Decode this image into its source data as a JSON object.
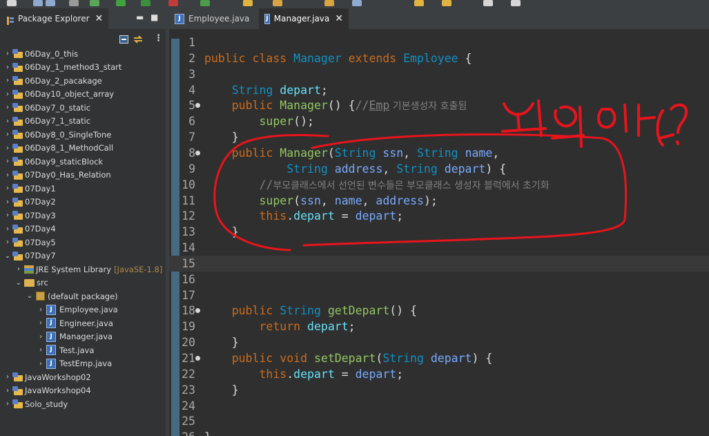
{
  "explorer": {
    "title": "Package Explorer",
    "close_icon": "close-icon",
    "minimize_icon": "minimize-icon",
    "maximize_icon": "maximize-icon",
    "tree": [
      {
        "label": "06Day_0_this",
        "kind": "project",
        "expanded": false
      },
      {
        "label": "06Day_1_method3_start",
        "kind": "project",
        "expanded": false
      },
      {
        "label": "06Day_2_pacakage",
        "kind": "project",
        "expanded": false
      },
      {
        "label": "06Day10_object_array",
        "kind": "project",
        "expanded": false
      },
      {
        "label": "06Day7_0_static",
        "kind": "project",
        "expanded": false
      },
      {
        "label": "06Day7_1_static",
        "kind": "project",
        "expanded": false
      },
      {
        "label": "06Day8_0_SingleTone",
        "kind": "project",
        "expanded": false
      },
      {
        "label": "06Day8_1_MethodCall",
        "kind": "project",
        "expanded": false
      },
      {
        "label": "06Day9_staticBlock",
        "kind": "project",
        "expanded": false
      },
      {
        "label": "07Day0_Has_Relation",
        "kind": "project",
        "expanded": false
      },
      {
        "label": "07Day1",
        "kind": "project",
        "expanded": false
      },
      {
        "label": "07Day2",
        "kind": "project",
        "expanded": false
      },
      {
        "label": "07Day3",
        "kind": "project",
        "expanded": false
      },
      {
        "label": "07Day4",
        "kind": "project",
        "expanded": false
      },
      {
        "label": "07Day5",
        "kind": "project",
        "expanded": false
      },
      {
        "label": "07Day7",
        "kind": "project",
        "expanded": true
      },
      {
        "label": "JRE System Library",
        "hint": "[JavaSE-1.8]",
        "kind": "library",
        "expanded": false
      },
      {
        "label": "src",
        "kind": "src",
        "expanded": true
      },
      {
        "label": "(default package)",
        "kind": "package",
        "expanded": true
      },
      {
        "label": "Employee.java",
        "kind": "java",
        "expanded": false
      },
      {
        "label": "Engineer.java",
        "kind": "java",
        "expanded": false
      },
      {
        "label": "Manager.java",
        "kind": "java",
        "expanded": false
      },
      {
        "label": "Test.java",
        "kind": "java",
        "expanded": false
      },
      {
        "label": "TestEmp.java",
        "kind": "java",
        "expanded": false
      },
      {
        "label": "JavaWorkshop02",
        "kind": "project",
        "expanded": false
      },
      {
        "label": "JavaWorkshop04",
        "kind": "project",
        "expanded": false
      },
      {
        "label": "Solo_study",
        "kind": "project",
        "expanded": false
      }
    ]
  },
  "editor": {
    "tabs": [
      {
        "label": "Employee.java",
        "active": false
      },
      {
        "label": "Manager.java",
        "active": true
      }
    ],
    "current_line": 15,
    "lines": [
      {
        "n": "1",
        "fold": false,
        "t": []
      },
      {
        "n": "2",
        "fold": false,
        "t": [
          [
            "kw",
            "public "
          ],
          [
            "kw",
            "class "
          ],
          [
            "ty",
            "Manager "
          ],
          [
            "kw",
            "extends "
          ],
          [
            "ty",
            "Employee "
          ],
          [
            "p",
            "{"
          ]
        ]
      },
      {
        "n": "3",
        "fold": false,
        "t": []
      },
      {
        "n": "4",
        "fold": false,
        "t": [
          [
            "p",
            "    "
          ],
          [
            "ty",
            "String "
          ],
          [
            "fd",
            "depart"
          ],
          [
            "p",
            ";"
          ]
        ]
      },
      {
        "n": "5",
        "fold": true,
        "t": [
          [
            "p",
            "    "
          ],
          [
            "kw",
            "public "
          ],
          [
            "mt",
            "Manager"
          ],
          [
            "p",
            "() {"
          ],
          [
            "cm",
            "//"
          ],
          [
            "cmu",
            "Emp"
          ],
          [
            "cmk",
            " 기본생성자 호출됨"
          ]
        ]
      },
      {
        "n": "6",
        "fold": false,
        "t": [
          [
            "p",
            "        "
          ],
          [
            "mt",
            "super"
          ],
          [
            "p",
            "();"
          ]
        ]
      },
      {
        "n": "7",
        "fold": false,
        "t": [
          [
            "p",
            "    }"
          ]
        ]
      },
      {
        "n": "8",
        "fold": true,
        "t": [
          [
            "p",
            "    "
          ],
          [
            "kw",
            "public "
          ],
          [
            "mt",
            "Manager"
          ],
          [
            "p",
            "("
          ],
          [
            "ty",
            "String "
          ],
          [
            "pm",
            "ssn"
          ],
          [
            "p",
            ", "
          ],
          [
            "ty",
            "String "
          ],
          [
            "pm",
            "name"
          ],
          [
            "p",
            ","
          ]
        ]
      },
      {
        "n": "9",
        "fold": false,
        "t": [
          [
            "p",
            "            "
          ],
          [
            "ty",
            "String "
          ],
          [
            "pm",
            "address"
          ],
          [
            "p",
            ", "
          ],
          [
            "ty",
            "String "
          ],
          [
            "pm",
            "depart"
          ],
          [
            "p",
            ") {"
          ]
        ]
      },
      {
        "n": "10",
        "fold": false,
        "t": [
          [
            "p",
            "        "
          ],
          [
            "cm",
            "//"
          ],
          [
            "cmk",
            "부모클래스에서 선언된 변수들은 부모클래스 생성자 블럭에서 초기화"
          ]
        ]
      },
      {
        "n": "11",
        "fold": false,
        "t": [
          [
            "p",
            "        "
          ],
          [
            "mt",
            "super"
          ],
          [
            "p",
            "("
          ],
          [
            "pm",
            "ssn"
          ],
          [
            "p",
            ", "
          ],
          [
            "pm",
            "name"
          ],
          [
            "p",
            ", "
          ],
          [
            "pm",
            "address"
          ],
          [
            "p",
            ");"
          ]
        ]
      },
      {
        "n": "12",
        "fold": false,
        "t": [
          [
            "p",
            "        "
          ],
          [
            "kw",
            "this"
          ],
          [
            "p",
            "."
          ],
          [
            "fd",
            "depart"
          ],
          [
            "p",
            " = "
          ],
          [
            "pm",
            "depart"
          ],
          [
            "p",
            ";"
          ]
        ]
      },
      {
        "n": "13",
        "fold": false,
        "t": [
          [
            "p",
            "    }"
          ]
        ]
      },
      {
        "n": "14",
        "fold": false,
        "t": []
      },
      {
        "n": "15",
        "fold": false,
        "t": []
      },
      {
        "n": "16",
        "fold": false,
        "t": []
      },
      {
        "n": "17",
        "fold": false,
        "t": []
      },
      {
        "n": "18",
        "fold": true,
        "t": [
          [
            "p",
            "    "
          ],
          [
            "kw",
            "public "
          ],
          [
            "ty",
            "String "
          ],
          [
            "mt",
            "getDepart"
          ],
          [
            "p",
            "() {"
          ]
        ]
      },
      {
        "n": "19",
        "fold": false,
        "t": [
          [
            "p",
            "        "
          ],
          [
            "kw",
            "return "
          ],
          [
            "fd",
            "depart"
          ],
          [
            "p",
            ";"
          ]
        ]
      },
      {
        "n": "20",
        "fold": false,
        "t": [
          [
            "p",
            "    }"
          ]
        ]
      },
      {
        "n": "21",
        "fold": true,
        "t": [
          [
            "p",
            "    "
          ],
          [
            "kw",
            "public "
          ],
          [
            "kw",
            "void "
          ],
          [
            "mt",
            "setDepart"
          ],
          [
            "p",
            "("
          ],
          [
            "ty",
            "String "
          ],
          [
            "pm",
            "depart"
          ],
          [
            "p",
            ") {"
          ]
        ]
      },
      {
        "n": "22",
        "fold": false,
        "t": [
          [
            "p",
            "        "
          ],
          [
            "kw",
            "this"
          ],
          [
            "p",
            "."
          ],
          [
            "fd",
            "depart"
          ],
          [
            "p",
            " = "
          ],
          [
            "pm",
            "depart"
          ],
          [
            "p",
            ";"
          ]
        ]
      },
      {
        "n": "23",
        "fold": false,
        "t": [
          [
            "p",
            "    }"
          ]
        ]
      },
      {
        "n": "24",
        "fold": false,
        "t": []
      },
      {
        "n": "25",
        "fold": false,
        "t": []
      },
      {
        "n": "26",
        "fold": false,
        "t": [
          [
            "p",
            "}"
          ]
        ]
      }
    ]
  },
  "annotation": {
    "color": "#e8141c",
    "handwriting": "뭐임 이거?"
  }
}
